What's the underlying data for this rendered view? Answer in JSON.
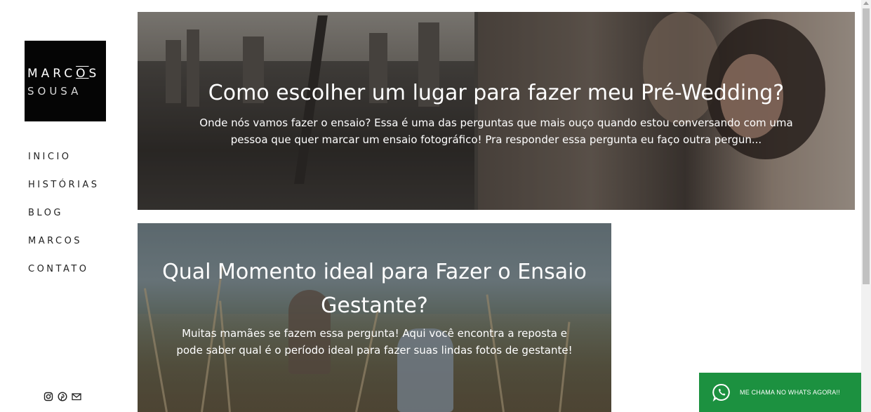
{
  "logo": {
    "line1": "MARC",
    "camera": "O",
    "line1_end": "S",
    "line2": "SOUSA"
  },
  "nav": [
    {
      "label": "INICIO"
    },
    {
      "label": "HISTÓRIAS"
    },
    {
      "label": "BLOG"
    },
    {
      "label": "MARCOS"
    },
    {
      "label": "CONTATO"
    }
  ],
  "social": [
    "instagram-icon",
    "pinterest-icon",
    "email-icon"
  ],
  "posts": [
    {
      "title": "Como escolher um lugar para fazer meu Pré-Wedding?",
      "excerpt": "Onde nós vamos fazer o ensaio? Essa é uma das perguntas que mais ouço quando estou conversando com uma pessoa que quer marcar um ensaio fotográfico! Pra responder essa pergunta eu faço outra pergun..."
    },
    {
      "title": "Qual Momento ideal para Fazer o Ensaio Gestante?",
      "excerpt": "Muitas mamães se fazem essa pergunta! Aqui você encontra a reposta e pode saber qual é o período ideal para fazer suas lindas fotos de gestante!"
    }
  ],
  "whatsapp": {
    "label": "ME CHAMA NO WHATS AGORA!!",
    "icon": "whatsapp-icon",
    "color": "#1c9140"
  }
}
